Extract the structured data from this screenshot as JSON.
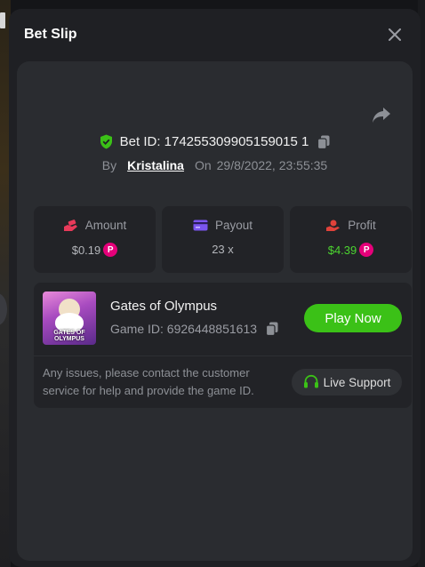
{
  "modal": {
    "title": "Bet Slip"
  },
  "bet": {
    "id_label": "Bet ID: 174255309905159015 1",
    "by_label": "By",
    "user": "Kristalina",
    "on_label": "On",
    "datetime": "29/8/2022, 23:55:35"
  },
  "stats": [
    {
      "label": "Amount",
      "value": "$0.19",
      "icon": "wallet-hand-icon",
      "has_coin": true
    },
    {
      "label": "Payout",
      "value": "23 x",
      "icon": "credit-card-icon",
      "has_coin": false
    },
    {
      "label": "Profit",
      "value": "$4.39",
      "icon": "coin-hand-icon",
      "has_coin": true
    }
  ],
  "coin_symbol": "P",
  "game": {
    "name": "Gates of Olympus",
    "id_label": "Game ID: 6926448851613",
    "thumb_text": "GATES OF OLYMPUS",
    "play_label": "Play Now"
  },
  "issues_text": "Any issues, please contact the customer service for help and provide the game ID.",
  "support_label": "Live Support",
  "colors": {
    "accent_green": "#3bc117",
    "profit_green": "#4cd430",
    "coin_pink": "#e6007a",
    "amount_icon": "#e83a5a",
    "payout_icon": "#7a55f0",
    "profit_icon": "#e0423a",
    "shield_green": "#3bc117"
  }
}
